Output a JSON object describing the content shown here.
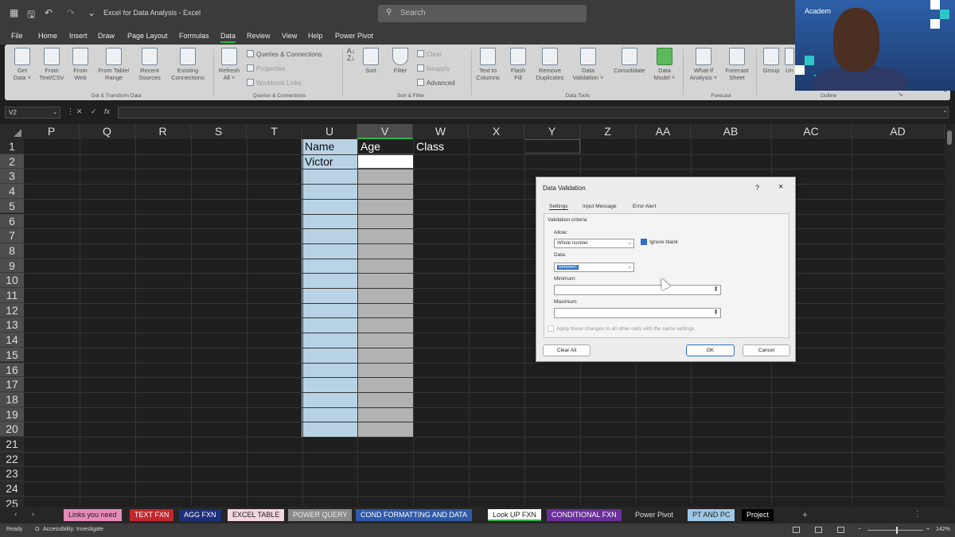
{
  "titlebar": {
    "title": "Excel for Data Analysis  -  Excel",
    "search_placeholder": "Search"
  },
  "menu": [
    "File",
    "Home",
    "Insert",
    "Draw",
    "Page Layout",
    "Formulas",
    "Data",
    "Review",
    "View",
    "Help",
    "Power Pivot"
  ],
  "ribbon": {
    "get_data": "Get\nData ˅",
    "from_text": "From\nText/CSV",
    "from_web": "From\nWeb",
    "from_table": "From Table/\nRange",
    "recent_sources": "Recent\nSources",
    "existing_connections": "Existing\nConnections",
    "group_get": "Get & Transform Data",
    "refresh_all": "Refresh\nAll ˅",
    "queries_connections": "Queries & Connections",
    "properties": "Properties",
    "workbook_links": "Workbook Links",
    "group_queries": "Queries & Connections",
    "sort": "Sort",
    "filter": "Filter",
    "clear": "Clear",
    "reapply": "Reapply",
    "advanced": "Advanced",
    "group_sort": "Sort & Filter",
    "text_to_columns": "Text to\nColumns",
    "flash_fill": "Flash\nFill",
    "remove_duplicates": "Remove\nDuplicates",
    "data_validation": "Data\nValidation ˅",
    "consolidate": "Consolidate",
    "data_model": "Data\nModel ˅",
    "group_tools": "Data Tools",
    "what_if": "What-If\nAnalysis ˅",
    "forecast_sheet": "Forecast\nSheet",
    "group_forecast": "Forecast",
    "group": "Group",
    "ungroup": "Un",
    "group_outline": "Outline"
  },
  "formula_bar": {
    "name_box": "V2",
    "fx": "fx",
    "value": ""
  },
  "columns": [
    "P",
    "Q",
    "R",
    "S",
    "T",
    "U",
    "V",
    "W",
    "X",
    "Y",
    "Z",
    "AA",
    "AB",
    "AC",
    "AD"
  ],
  "rows": [
    "1",
    "2",
    "3",
    "4",
    "5",
    "6",
    "7",
    "8",
    "9",
    "10",
    "11",
    "12",
    "13",
    "14",
    "15",
    "16",
    "17",
    "18",
    "19",
    "20",
    "21",
    "22",
    "23",
    "24",
    "25"
  ],
  "cells": {
    "U1": "Name",
    "V1": "Age",
    "W1": "Class",
    "U2": "Victor"
  },
  "dialog": {
    "title": "Data Validation",
    "help": "?",
    "close": "×",
    "tabs": [
      "Settings",
      "Input Message",
      "Error Alert"
    ],
    "section": "Validation criteria",
    "allow_label": "Allow:",
    "allow_value": "Whole number",
    "ignore_blank": "Ignore blank",
    "data_label": "Data:",
    "data_value": "between",
    "minimum_label": "Minimum:",
    "maximum_label": "Maximum:",
    "apply_all": "Apply these changes to all other cells with the same settings",
    "clear_all": "Clear All",
    "ok": "OK",
    "cancel": "Cancel"
  },
  "sheet_tabs": [
    {
      "label": "Links you need",
      "bg": "#e58bb8",
      "fg": "#222"
    },
    {
      "label": "TEXT FXN",
      "bg": "#c0272d",
      "fg": "#fff"
    },
    {
      "label": "AGG FXN",
      "bg": "#1b2f7a",
      "fg": "#fff"
    },
    {
      "label": "EXCEL TABLE",
      "bg": "#f2d6df",
      "fg": "#222"
    },
    {
      "label": "POWER QUERY",
      "bg": "#8a8a8a",
      "fg": "#eee"
    },
    {
      "label": "COND FORMATTING AND DATA",
      "bg": "#2f5aa8",
      "fg": "#fff"
    },
    {
      "label": "Look UP FXN",
      "bg": "#ffffff",
      "fg": "#222"
    },
    {
      "label": "CONDITIONAL FXN",
      "bg": "#6a2f9a",
      "fg": "#fff"
    },
    {
      "label": "Power Pivot",
      "bg": "#262626",
      "fg": "#ddd"
    },
    {
      "label": "PT AND PC",
      "bg": "#9fc8e6",
      "fg": "#222"
    },
    {
      "label": "Project",
      "bg": "#000000",
      "fg": "#fff"
    }
  ],
  "status": {
    "ready": "Ready",
    "accessibility": "Accessibility: Investigate",
    "zoom": "142%"
  },
  "webcam": {
    "brand": "Academ"
  }
}
